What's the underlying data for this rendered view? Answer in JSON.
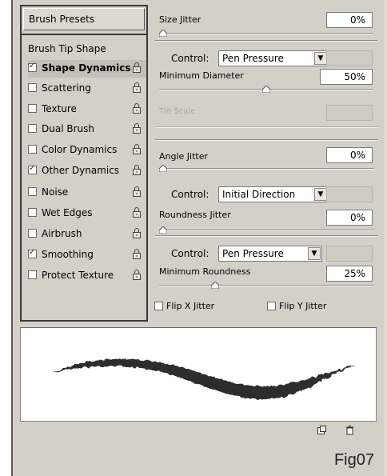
{
  "panel": {
    "brush_presets_label": "Brush Presets",
    "tip_shape_label": "Brush Tip Shape",
    "options": [
      {
        "label": "Shape Dynamics",
        "checked": true,
        "active": true
      },
      {
        "label": "Scattering",
        "checked": false
      },
      {
        "label": "Texture",
        "checked": false
      },
      {
        "label": "Dual Brush",
        "checked": false
      },
      {
        "label": "Color Dynamics",
        "checked": false
      },
      {
        "label": "Other Dynamics",
        "checked": true
      },
      {
        "label": "Noise",
        "checked": false
      },
      {
        "label": "Wet Edges",
        "checked": false
      },
      {
        "label": "Airbrush",
        "checked": false
      },
      {
        "label": "Smoothing",
        "checked": true
      },
      {
        "label": "Protect Texture",
        "checked": false
      }
    ]
  },
  "controls": {
    "size_jitter": {
      "label": "Size Jitter",
      "value": "0%",
      "slider": 0
    },
    "control1": {
      "label": "Control:",
      "value": "Pen Pressure"
    },
    "min_diameter": {
      "label": "Minimum Diameter",
      "value": "50%",
      "slider": 0.5
    },
    "tilt_scale": {
      "label": "Tilt Scale"
    },
    "angle_jitter": {
      "label": "Angle Jitter",
      "value": "0%",
      "slider": 0
    },
    "control2": {
      "label": "Control:",
      "value": "Initial Direction"
    },
    "roundness_jitter": {
      "label": "Roundness Jitter",
      "value": "0%",
      "slider": 0
    },
    "control3": {
      "label": "Control:",
      "value": "Pen Pressure"
    },
    "min_roundness": {
      "label": "Minimum Roundness",
      "value": "25%",
      "slider": 0.25
    },
    "flip_x": {
      "label": "Flip X Jitter",
      "checked": false
    },
    "flip_y": {
      "label": "Flip Y Jitter",
      "checked": false
    }
  },
  "figure_label": "Fig07",
  "colors": {
    "panel_bg": "#d4d0c8",
    "frame_border": "#6b5a4e"
  }
}
